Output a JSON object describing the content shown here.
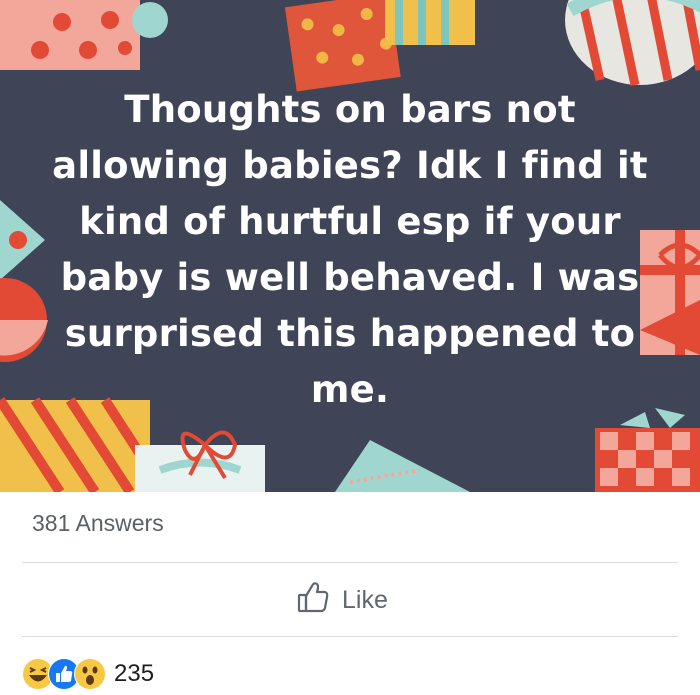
{
  "post": {
    "text": "Thoughts on bars not allowing babies? Idk I find it kind of hurtful esp if your baby is well behaved. I was surprised this happened to me."
  },
  "answers": {
    "label": "381 Answers"
  },
  "actions": {
    "like_label": "Like"
  },
  "reactions": {
    "icons": [
      "laughing-emoji",
      "like-thumb",
      "wow-emoji"
    ],
    "count": "235"
  },
  "colors": {
    "banner_bg": "#3f4457",
    "like_blue": "#1877f2",
    "reaction_yellow": "#f7c844"
  }
}
